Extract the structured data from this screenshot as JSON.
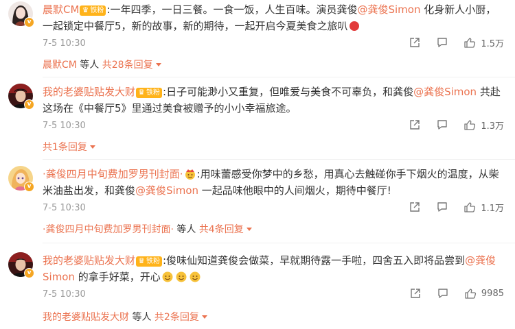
{
  "comments": [
    {
      "username": "晨默CM",
      "badge": "铁粉",
      "text_before": ":一年四季，一日三餐。一食一饭，人生百味。演员龚俊",
      "mention": "@龚俊Simon",
      "text_after": " 化身新人小厨，一起锁定中餐厅5，新的故事，新的期待，一起开启今夏美食之旅叭",
      "time": "7-5 10:30",
      "likes": "1.5万",
      "reply_user": "晨默CM",
      "reply_mid": " 等人 ",
      "reply_count": "共28条回复"
    },
    {
      "username": "我的老婆贴贴发大财",
      "badge": "铁粉",
      "text_before": ":日子可能渺小又重复，但唯爱与美食不可辜负，和龚俊",
      "mention": "@龚俊Simon",
      "text_after": " 共赴这场在《中餐厅5》里通过美食被赠予的小小幸福旅途。",
      "time": "7-5 10:30",
      "likes": "1.3万",
      "reply_count": "共1条回复"
    },
    {
      "username": "·龚俊四月中旬费加罗男刊封面·",
      "badge": "",
      "text_before": ":用味蕾感受你梦中的乡愁，用真心去触碰你手下烟火的温度，从柴米油盐出发，和龚俊",
      "mention": "@龚俊Simon",
      "text_after": " 一起品味他眼中的人间烟火，期待中餐厅!",
      "time": "7-5 10:30",
      "likes": "1.1万",
      "reply_user": "·龚俊四月中旬费加罗男刊封面·",
      "reply_mid": " 等人 ",
      "reply_count": "共4条回复"
    },
    {
      "username": "我的老婆贴贴发大财",
      "badge": "铁粉",
      "text_before": ":俊味仙知道龚俊会做菜，早就期待露一手啦，四舍五入即将品尝到",
      "mention": "@龚俊Simon",
      "text_after": " 的拿手好菜，开心",
      "time": "7-5 10:30",
      "likes": "9985",
      "reply_user": "我的老婆贴贴发大财",
      "reply_mid": " 等人 ",
      "reply_count": "共2条回复"
    }
  ],
  "icons": {
    "share": "share-icon",
    "comment": "comment-icon",
    "like": "thumbs-up-icon"
  },
  "colors": {
    "accent": "#eb7350",
    "meta": "#999999",
    "badge": "#ffb31a"
  }
}
